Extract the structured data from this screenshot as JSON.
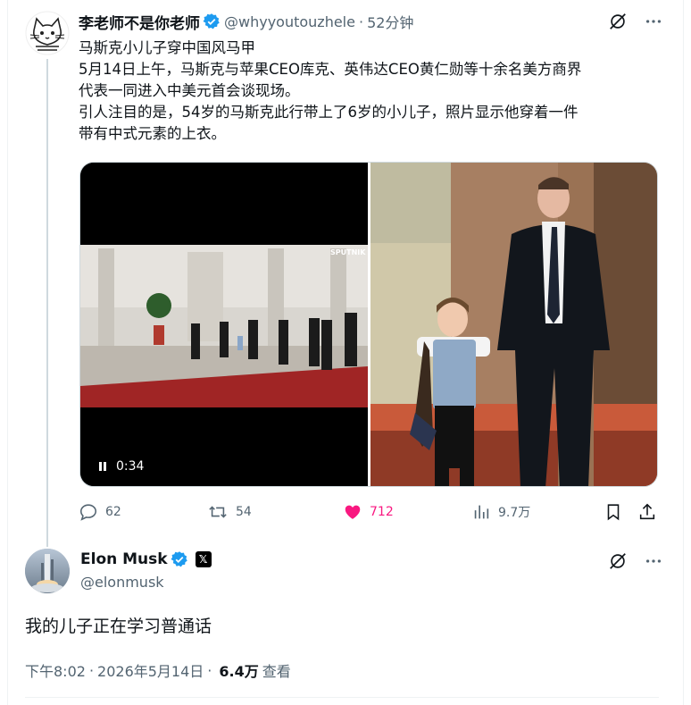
{
  "parent": {
    "name": "李老师不是你老师",
    "handle": "@whyyoutouzhele",
    "dot": "·",
    "time": "52分钟",
    "lines": [
      "马斯克小儿子穿中国风马甲",
      "5月14日上午，马斯克与苹果CEO库克、英伟达CEO黄仁勋等十余名美方商界",
      "代表一同进入中美元首会谈现场。",
      "引人注目的是，54岁的马斯克此行带上了6岁的小儿子，照片显示他穿着一件",
      "带有中式元素的上衣。"
    ],
    "video_time": "0:34",
    "video_watermark": "SPUTNIK",
    "stats": {
      "replies": "62",
      "reposts": "54",
      "likes": "712",
      "views": "9.7万"
    }
  },
  "reply": {
    "name": "Elon Musk",
    "badge": "𝕏",
    "handle": "@elonmusk",
    "text": "我的儿子正在学习普通话",
    "time": "下午8:02",
    "sep": "·",
    "date": "2026年5月14日",
    "sep2": "·",
    "views": "6.4万",
    "views_label": "查看"
  },
  "colors": {
    "accent": "#1d9bf0",
    "like": "#f91880",
    "muted": "#536471",
    "text": "#0f1419"
  },
  "icons": [
    "grok-icon",
    "more-icon",
    "reply-icon",
    "repost-icon",
    "like-icon",
    "views-icon",
    "bookmark-icon",
    "share-icon",
    "verified-icon",
    "x-badge-icon",
    "pause-icon"
  ]
}
